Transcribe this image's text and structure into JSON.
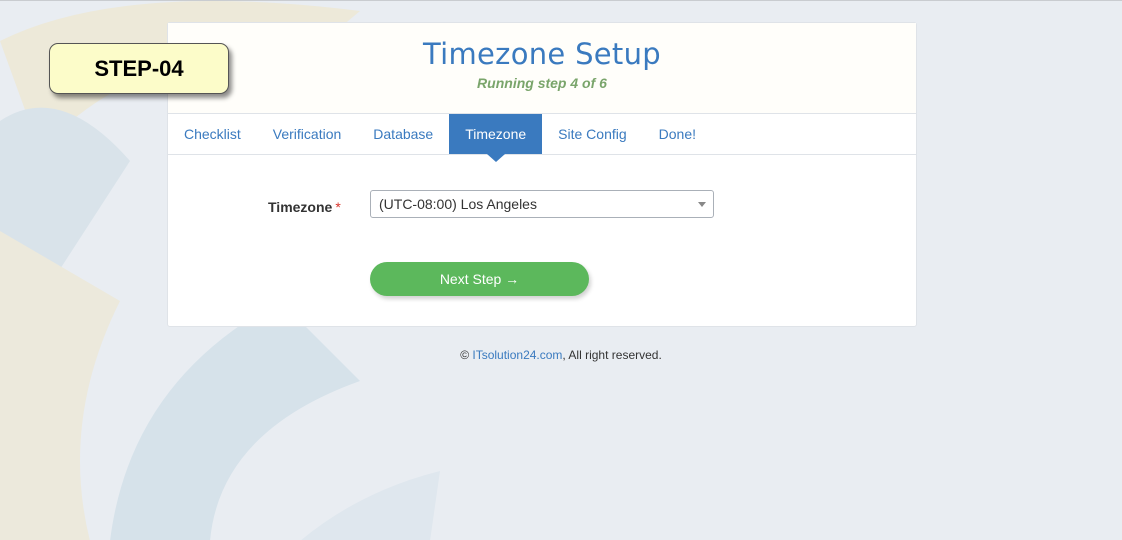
{
  "badge": {
    "label": "STEP-04"
  },
  "header": {
    "title": "Timezone Setup",
    "subtitle": "Running step 4 of 6"
  },
  "tabs": [
    {
      "label": "Checklist",
      "active": false
    },
    {
      "label": "Verification",
      "active": false
    },
    {
      "label": "Database",
      "active": false
    },
    {
      "label": "Timezone",
      "active": true
    },
    {
      "label": "Site Config",
      "active": false
    },
    {
      "label": "Done!",
      "active": false
    }
  ],
  "form": {
    "timezone_label": "Timezone",
    "required_mark": "*",
    "timezone_value": "(UTC-08:00) Los Angeles",
    "next_button": "Next Step →"
  },
  "footer": {
    "copyright": "©",
    "link_text": "ITsolution24.com",
    "suffix": ", All right reserved."
  },
  "colors": {
    "accent": "#3a7abf",
    "button": "#5cb85c",
    "subtitle": "#7aa56b",
    "badge_bg": "#fcfcc9"
  }
}
